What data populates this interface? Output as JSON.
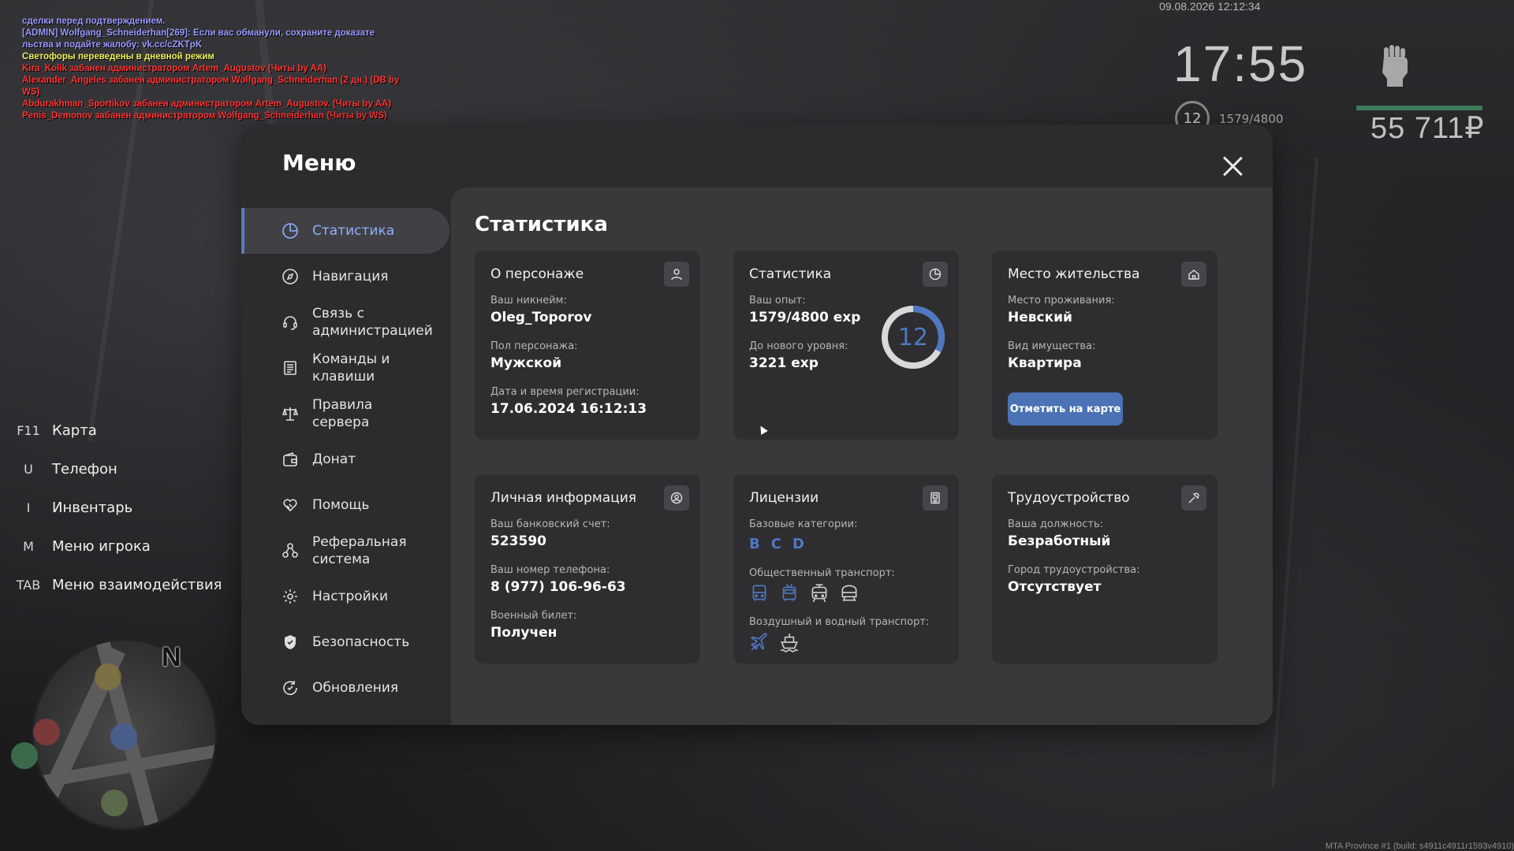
{
  "chat": {
    "lines": [
      {
        "text": "сделки перед подтверждением.",
        "color": "#9a9aff"
      },
      {
        "text": "[ADMIN] Wolfgang_Schneiderhan[269]: Если вас обманули, сохраните доказате льства и подайте жалобу: vk.cc/cZKTpK",
        "color": "#9a9aff"
      },
      {
        "text": "Светофоры переведены в дневной режим",
        "color": "#f2f25a"
      },
      {
        "text": "Kira_Kolik забанен администратором Artem_Augustov (Читы by AA)",
        "color": "#ff3333"
      },
      {
        "text": "Alexander_Angeles забанен администратором Wolfgang_Schneiderhan (2 дн.) (DB by WS)",
        "color": "#ff3333"
      },
      {
        "text": "Abdurakhman_Sportikov забанен администратором Artem_Augustov. (Читы by AA)",
        "color": "#ff3333"
      },
      {
        "text": "Penis_Demonov забанен администратором Wolfgang_Schneiderhan (Читы by WS)",
        "color": "#ff3333"
      }
    ]
  },
  "hud": {
    "datetime": "09.08.2026 12:12:34",
    "time": "17:55",
    "level": "12",
    "exp": "1579/4800",
    "money": "55 711₽",
    "health_fraction": 1.0
  },
  "keyhints": [
    {
      "key": "F11",
      "label": "Карта"
    },
    {
      "key": "U",
      "label": "Телефон"
    },
    {
      "key": "I",
      "label": "Инвентарь"
    },
    {
      "key": "M",
      "label": "Меню игрока"
    },
    {
      "key": "TAB",
      "label": "Меню взаимодействия"
    }
  ],
  "minimap": {
    "north": "N"
  },
  "build": "MTA Province #1 (build: s4911c4911r1593v4910)",
  "menu": {
    "title": "Меню",
    "nav": [
      {
        "label": "Статистика",
        "icon": "pie-chart-icon",
        "active": true
      },
      {
        "label": "Навигация",
        "icon": "compass-icon",
        "active": false
      },
      {
        "label": "Связь с администрацией",
        "icon": "headset-icon",
        "active": false
      },
      {
        "label": "Команды и клавиши",
        "icon": "document-list-icon",
        "active": false
      },
      {
        "label": "Правила сервера",
        "icon": "scales-icon",
        "active": false
      },
      {
        "label": "Донат",
        "icon": "wallet-icon",
        "active": false
      },
      {
        "label": "Помощь",
        "icon": "handshake-heart-icon",
        "active": false
      },
      {
        "label": "Реферальная система",
        "icon": "people-network-icon",
        "active": false
      },
      {
        "label": "Настройки",
        "icon": "gear-icon",
        "active": false
      },
      {
        "label": "Безопасность",
        "icon": "shield-icon",
        "active": false
      },
      {
        "label": "Обновления",
        "icon": "refresh-check-icon",
        "active": false
      }
    ]
  },
  "stats": {
    "title": "Статистика",
    "character": {
      "title": "О персонаже",
      "nick_label": "Ваш никнейм:",
      "nick": "Oleg_Toporov",
      "gender_label": "Пол персонажа:",
      "gender": "Мужской",
      "reg_label": "Дата и время регистрации:",
      "reg": "17.06.2024 16:12:13"
    },
    "statistics": {
      "title": "Статистика",
      "exp_label": "Ваш опыт:",
      "exp": "1579/4800 exp",
      "next_label": "До нового уровня:",
      "next": "3221 exp",
      "level": "12",
      "progress": 0.329
    },
    "residence": {
      "title": "Место жительства",
      "place_label": "Место проживания:",
      "place": "Невский",
      "type_label": "Вид имущества:",
      "type": "Квартира",
      "button": "Отметить на карте"
    },
    "personal": {
      "title": "Личная информация",
      "bank_label": "Ваш банковский счет:",
      "bank": "523590",
      "phone_label": "Ваш номер телефона:",
      "phone": "8 (977) 106-96-63",
      "military_label": "Военный билет:",
      "military": "Получен"
    },
    "licenses": {
      "title": "Лицензии",
      "base_label": "Базовые категории:",
      "categories": [
        "B",
        "C",
        "D"
      ],
      "public_label": "Общественный транспорт:",
      "air_label": "Воздушный и водный транспорт:"
    },
    "employment": {
      "title": "Трудоустройство",
      "position_label": "Ваша должность:",
      "position": "Безработный",
      "city_label": "Город трудоустройства:",
      "city": "Отсутствует"
    }
  },
  "colors": {
    "accent": "#4f78c2",
    "button": "#4a72b4",
    "active_text": "#8fb0ff"
  }
}
